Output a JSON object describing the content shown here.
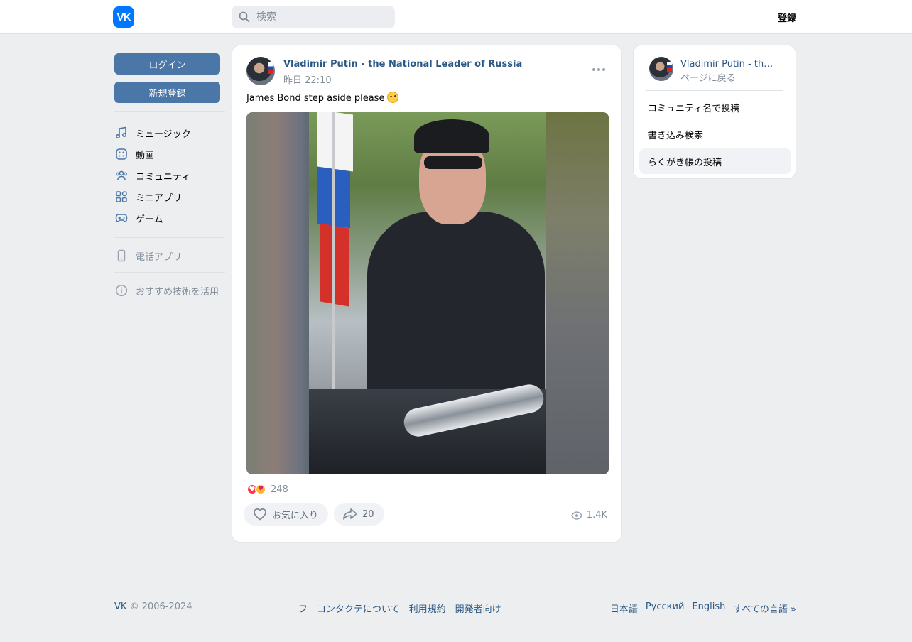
{
  "header": {
    "logo_text": "VK",
    "search_placeholder": "検索",
    "register_label": "登録"
  },
  "sidebar": {
    "login_label": "ログイン",
    "signup_label": "新規登録",
    "nav": [
      {
        "label": "ミュージック",
        "icon": "music-icon"
      },
      {
        "label": "動画",
        "icon": "video-icon"
      },
      {
        "label": "コミュニティ",
        "icon": "community-icon"
      },
      {
        "label": "ミニアプリ",
        "icon": "mini-apps-icon"
      },
      {
        "label": "ゲーム",
        "icon": "gamepad-icon"
      }
    ],
    "phone_app_label": "電話アプリ",
    "recommend_label": "おすすめ技術を活用"
  },
  "post": {
    "author": "Vladimir Putin - the National Leader of Russia",
    "time": "昨日 22:10",
    "text": "James Bond step aside please",
    "reaction_count": "248",
    "like_label": "お気に入り",
    "share_count": "20",
    "views": "1.4K"
  },
  "right": {
    "name": "Vladimir Putin - the National Leader of Russia",
    "back_label": "ページに戻る",
    "items": [
      {
        "label": "コミュニティ名で投稿"
      },
      {
        "label": "書き込み検索"
      },
      {
        "label": "らくがき帳の投稿"
      }
    ]
  },
  "footer": {
    "vk": "VK",
    "copyright": "© 2006-2024",
    "links": [
      "フ",
      "コンタクテについて",
      "利用規約",
      "開発者向け"
    ],
    "langs": [
      "日本語",
      "Русский",
      "English",
      "すべての言語 »"
    ]
  },
  "colors": {
    "accent": "#4a76a8",
    "link": "#2a5885",
    "brand": "#0077ff",
    "background": "#edeef0"
  }
}
